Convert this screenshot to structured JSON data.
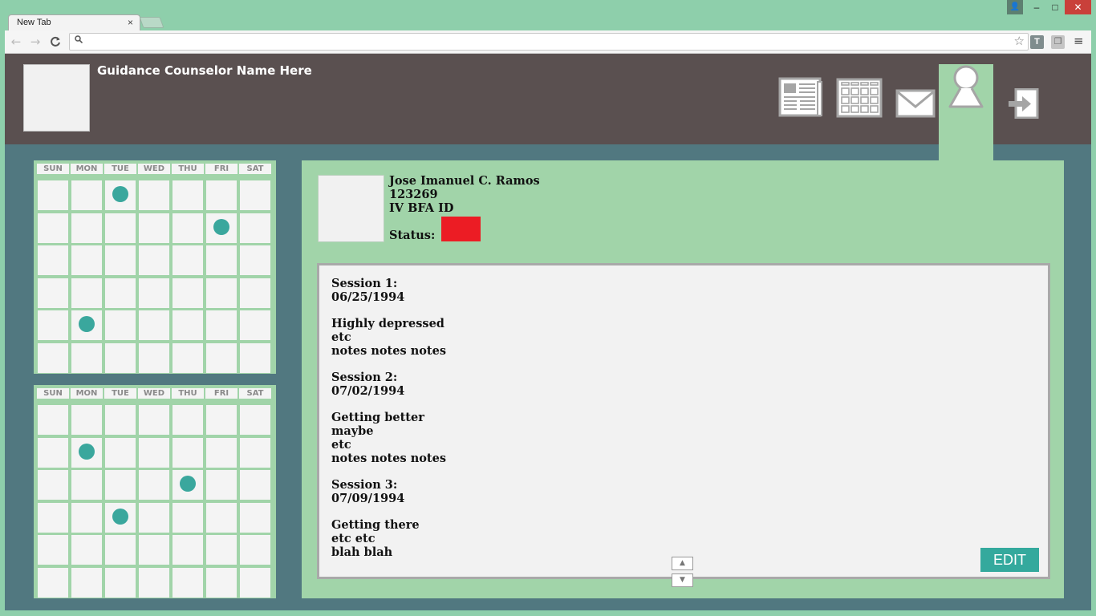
{
  "browser": {
    "tab_title": "New Tab",
    "tab_close": "×",
    "window_buttons": {
      "user": "👤",
      "minimize": "–",
      "maximize": "□",
      "close": "✕"
    },
    "toolbar": {
      "back": "←",
      "forward": "→",
      "reload": "C",
      "url_value": "",
      "star": "☆",
      "ext_t": "T",
      "ext_2": "❐",
      "menu": "≡"
    }
  },
  "header": {
    "counselor_name": "Guidance Counselor Name Here",
    "nav_icons": [
      "newspaper-icon",
      "calendar-grid-icon",
      "mail-icon",
      "profile-icon",
      "logout-icon"
    ],
    "active_nav": "profile-icon"
  },
  "calendars": [
    {
      "days": [
        "SUN",
        "MON",
        "TUE",
        "WED",
        "THU",
        "FRI",
        "SAT"
      ],
      "weeks": 6,
      "marked": [
        [
          0,
          2
        ],
        [
          1,
          5
        ],
        [
          4,
          1
        ]
      ]
    },
    {
      "days": [
        "SUN",
        "MON",
        "TUE",
        "WED",
        "THU",
        "FRI",
        "SAT"
      ],
      "weeks": 6,
      "marked": [
        [
          1,
          1
        ],
        [
          2,
          4
        ],
        [
          3,
          2
        ]
      ]
    }
  ],
  "student": {
    "name": "Jose Imanuel C. Ramos",
    "id_number": "123269",
    "program": "IV BFA ID",
    "status_label": "Status:",
    "status_color": "#ec1c24"
  },
  "notes": [
    [
      "Session 1:",
      "06/25/1994"
    ],
    [
      "Highly depressed",
      "etc",
      "notes notes notes"
    ],
    [
      "Session 2:",
      "07/02/1994"
    ],
    [
      "Getting better",
      "maybe",
      "etc",
      "notes notes notes"
    ],
    [
      "Session 3:",
      "07/09/1994"
    ],
    [
      "Getting there",
      "etc etc",
      "blah blah"
    ]
  ],
  "edit_label": "EDIT",
  "scroll": {
    "up": "▲",
    "down": "▼"
  },
  "colors": {
    "header_bg": "#5a5050",
    "app_bg": "#517880",
    "panel_bg": "#a1d4a9",
    "accent": "#3aa79d"
  }
}
